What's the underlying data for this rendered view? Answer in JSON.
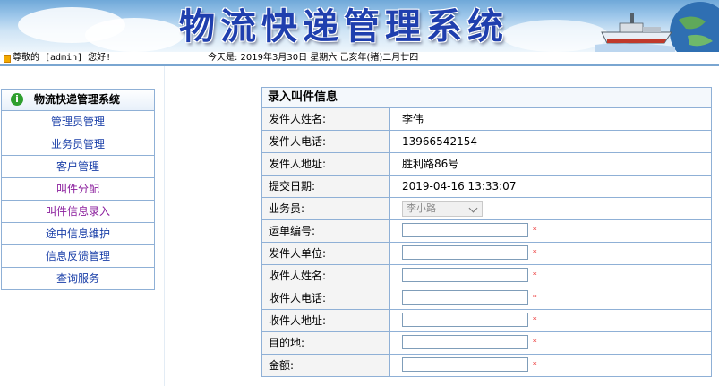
{
  "header": {
    "title": "物流快递管理系统",
    "welcome": "尊敬的 [admin] 您好!",
    "date": "今天是: 2019年3月30日 星期六 己亥年(猪)二月廿四"
  },
  "sidebar": {
    "title": "物流快递管理系统",
    "items": [
      {
        "label": "管理员管理"
      },
      {
        "label": "业务员管理"
      },
      {
        "label": "客户管理"
      },
      {
        "label": "叫件分配"
      },
      {
        "label": "叫件信息录入"
      },
      {
        "label": "途中信息维护"
      },
      {
        "label": "信息反馈管理"
      },
      {
        "label": "查询服务"
      }
    ]
  },
  "form": {
    "title": "录入叫件信息",
    "sender_name_label": "发件人姓名:",
    "sender_name": "李伟",
    "sender_phone_label": "发件人电话:",
    "sender_phone": "13966542154",
    "sender_addr_label": "发件人地址:",
    "sender_addr": "胜利路86号",
    "submit_date_label": "提交日期:",
    "submit_date": "2019-04-16 13:33:07",
    "salesman_label": "业务员:",
    "salesman": "李小路",
    "waybill_label": "运单编号:",
    "waybill": "",
    "sender_unit_label": "发件人单位:",
    "sender_unit": "",
    "receiver_name_label": "收件人姓名:",
    "receiver_name": "",
    "receiver_phone_label": "收件人电话:",
    "receiver_phone": "",
    "receiver_addr_label": "收件人地址:",
    "receiver_addr": "",
    "destination_label": "目的地:",
    "destination": "",
    "amount_label": "金额:",
    "amount": "",
    "required_mark": "*"
  },
  "colors": {
    "title_blue": "#1f3fae",
    "link_blue": "#1a3fa8",
    "link_visited": "#8a1c9c",
    "border": "#8fb0d6",
    "required": "#e60000"
  }
}
